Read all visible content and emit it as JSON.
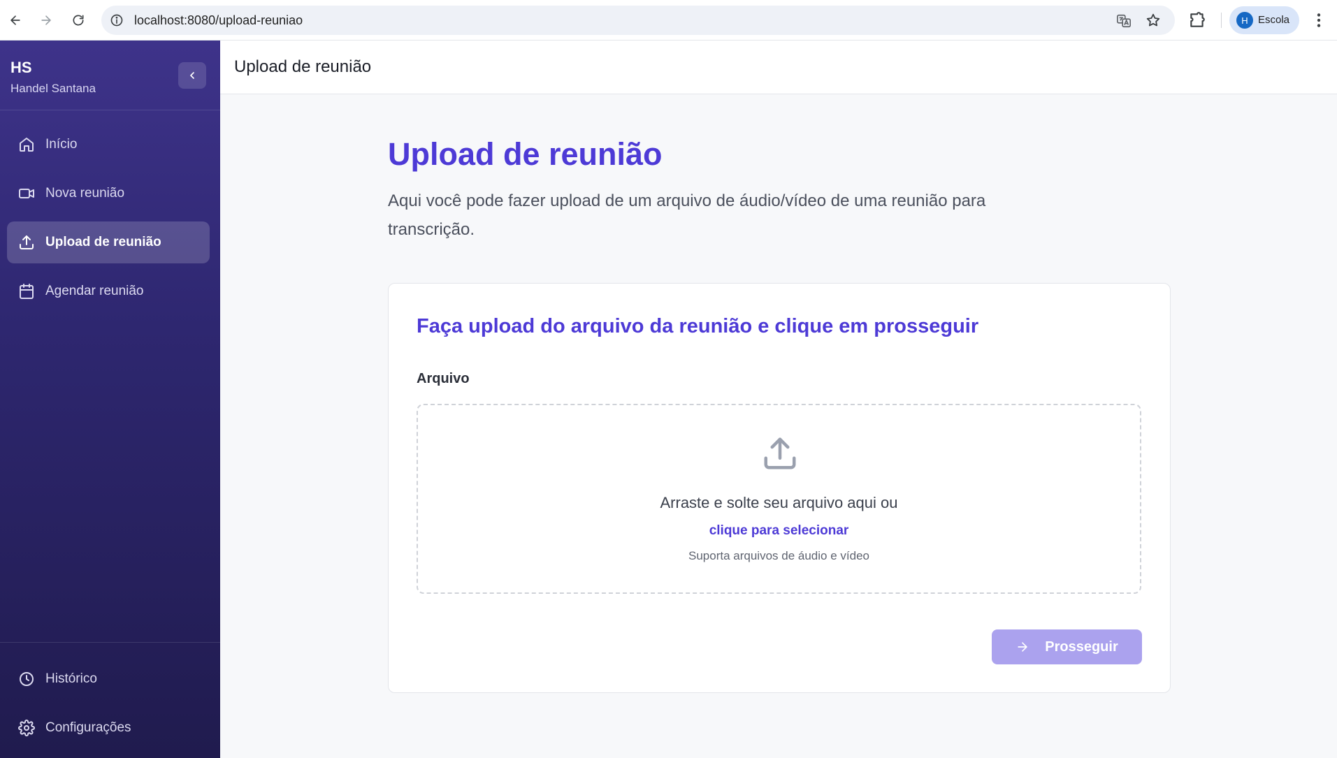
{
  "browser": {
    "url": "localhost:8080/upload-reuniao",
    "profile_initial": "H",
    "profile_name": "Escola"
  },
  "sidebar": {
    "user_initials": "HS",
    "user_name": "Handel Santana",
    "items": [
      {
        "label": "Início",
        "icon": "home-icon",
        "active": false
      },
      {
        "label": "Nova reunião",
        "icon": "video-icon",
        "active": false
      },
      {
        "label": "Upload de reunião",
        "icon": "upload-icon",
        "active": true
      },
      {
        "label": "Agendar reunião",
        "icon": "calendar-icon",
        "active": false
      }
    ],
    "bottom_items": [
      {
        "label": "Histórico",
        "icon": "clock-icon"
      },
      {
        "label": "Configurações",
        "icon": "gear-icon"
      }
    ]
  },
  "topbar": {
    "title": "Upload de reunião"
  },
  "main": {
    "title": "Upload de reunião",
    "description": "Aqui você pode fazer upload de um arquivo de áudio/vídeo de uma reunião para transcrição.",
    "card": {
      "title": "Faça upload do arquivo da reunião e clique em prosseguir",
      "field_label": "Arquivo",
      "dropzone": {
        "main_text": "Arraste e solte seu arquivo aqui ou",
        "link_text": "clique para selecionar",
        "hint_text": "Suporta arquivos de áudio e vídeo"
      },
      "proceed_label": "Prosseguir"
    }
  },
  "colors": {
    "accent": "#4d3ad6",
    "sidebar_top": "#3e338a",
    "sidebar_bottom": "#201b4e",
    "button_disabled": "#aba2ee"
  }
}
